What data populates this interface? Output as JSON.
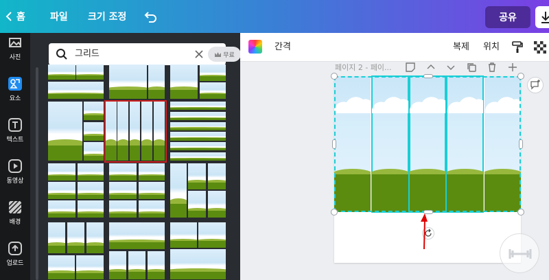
{
  "topbar": {
    "home_label": "홈",
    "menu": [
      "파일",
      "크기 조정"
    ],
    "share_label": "공유",
    "colors": {
      "gradient_start": "#12b6c9",
      "gradient_end": "#7a3fe4"
    }
  },
  "rail": {
    "items": [
      {
        "label": "사진",
        "icon": "photo-icon"
      },
      {
        "label": "요소",
        "icon": "elements-icon",
        "active": true
      },
      {
        "label": "텍스트",
        "icon": "text-icon"
      },
      {
        "label": "동영상",
        "icon": "video-icon"
      },
      {
        "label": "배경",
        "icon": "background-icon"
      },
      {
        "label": "업로드",
        "icon": "upload-icon"
      }
    ]
  },
  "panel": {
    "search": {
      "value": "그리드"
    },
    "badge_label": "무료"
  },
  "toolbar": {
    "spacing_label": "간격",
    "duplicate_label": "복제",
    "position_label": "위치"
  },
  "canvas": {
    "page_label": "페이지 2 - 페이..."
  }
}
